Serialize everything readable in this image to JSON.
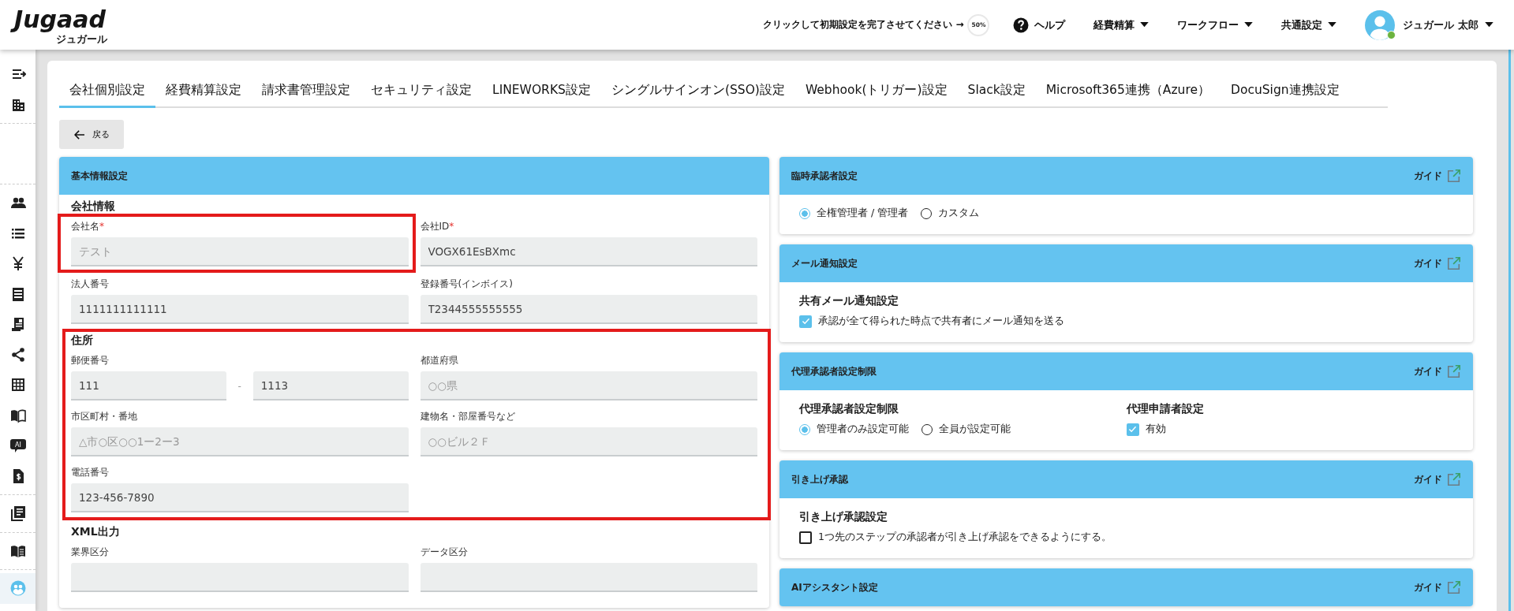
{
  "header": {
    "logo": "Jugaad",
    "logo_sub": "ジュガール",
    "setup_prompt": "クリックして初期設定を完了させてください →",
    "setup_progress": "50%",
    "menus": [
      {
        "label": "ヘルプ",
        "kind": "help"
      },
      {
        "label": "経費精算",
        "kind": "dropdown"
      },
      {
        "label": "ワークフロー",
        "kind": "dropdown"
      },
      {
        "label": "共通設定",
        "kind": "dropdown"
      }
    ],
    "user": {
      "name": "ジュガール 太郎",
      "online": true
    }
  },
  "sidebar": {
    "groups": [
      {
        "items": [
          {
            "selected": false
          },
          {
            "selected": false
          }
        ]
      },
      {
        "items": [
          {
            "selected": false
          },
          {
            "selected": false
          },
          {
            "selected": false
          },
          {
            "selected": false
          },
          {
            "selected": false
          },
          {
            "selected": false
          },
          {
            "selected": false
          },
          {
            "selected": false
          },
          {
            "selected": false,
            "label": "AI"
          },
          {
            "selected": false
          }
        ]
      },
      {
        "items": [
          {
            "selected": false
          }
        ]
      },
      {
        "items": [
          {
            "selected": false
          }
        ]
      },
      {
        "items": [
          {
            "selected": true
          }
        ]
      }
    ]
  },
  "tabs": [
    {
      "label": "会社個別設定",
      "selected": true
    },
    {
      "label": "経費精算設定",
      "selected": false
    },
    {
      "label": "請求書管理設定",
      "selected": false
    },
    {
      "label": "セキュリティ設定",
      "selected": false
    },
    {
      "label": "LINEWORKS設定",
      "selected": false
    },
    {
      "label": "シングルサインオン(SSO)設定",
      "selected": false
    },
    {
      "label": "Webhook(トリガー)設定",
      "selected": false
    },
    {
      "label": "Slack設定",
      "selected": false
    },
    {
      "label": "Microsoft365連携（Azure）",
      "selected": false
    },
    {
      "label": "DocuSign連携設定",
      "selected": false
    }
  ],
  "back_button": "戻る",
  "basic_panel": {
    "title": "基本情報設定",
    "sections": [
      {
        "title": "会社情報",
        "highlighted": false,
        "fields": [
          {
            "kind": "text",
            "label": "会社名",
            "required_mark": "*",
            "placeholder": "テスト",
            "highlighted": true
          },
          {
            "kind": "text",
            "label": "会社ID",
            "required_mark": "*",
            "value": "VOGX61EsBXmc",
            "highlighted": false
          },
          {
            "kind": "text",
            "label": "法人番号",
            "value": "1111111111111",
            "highlighted": false
          },
          {
            "kind": "text",
            "label": "登録番号(インボイス)",
            "value": "T2344555555555",
            "highlighted": false
          }
        ]
      },
      {
        "title": "住所",
        "highlighted": true,
        "fields": [
          {
            "kind": "postal",
            "label": "郵便番号",
            "values": [
              "111",
              "1113"
            ],
            "separator": "-",
            "highlighted": false
          },
          {
            "kind": "text",
            "label": "都道府県",
            "placeholder": "○○県",
            "highlighted": false
          },
          {
            "kind": "text",
            "label": "市区町村・番地",
            "placeholder": "△市○区○○1ー2ー3",
            "highlighted": false
          },
          {
            "kind": "text",
            "label": "建物名・部屋番号など",
            "placeholder": "○○ビル２Ｆ",
            "highlighted": false
          },
          {
            "kind": "text",
            "label": "電話番号",
            "value": "123-456-7890",
            "highlighted": false
          }
        ]
      },
      {
        "title": "XML出力",
        "highlighted": false,
        "fields": [
          {
            "kind": "text",
            "label": "業界区分",
            "highlighted": false
          },
          {
            "kind": "text",
            "label": "データ区分",
            "highlighted": false
          }
        ]
      }
    ]
  },
  "side_panels": [
    {
      "title": "臨時承認者設定",
      "guide": "ガイド",
      "groups": [
        {
          "controls": [
            {
              "kind": "radio",
              "label": "全権管理者 / 管理者",
              "selected": true
            },
            {
              "kind": "radio",
              "label": "カスタム",
              "selected": false
            }
          ]
        }
      ]
    },
    {
      "title": "メール通知設定",
      "guide": "ガイド",
      "groups": [
        {
          "heading": "共有メール通知設定",
          "controls": [
            {
              "kind": "checkbox",
              "label": "承認が全て得られた時点で共有者にメール通知を送る",
              "checked": true
            }
          ]
        }
      ]
    },
    {
      "title": "代理承認者設定制限",
      "guide": "ガイド",
      "groups": [
        {
          "heading": "代理承認者設定制限",
          "controls": [
            {
              "kind": "radio",
              "label": "管理者のみ設定可能",
              "selected": true
            },
            {
              "kind": "radio",
              "label": "全員が設定可能",
              "selected": false
            }
          ]
        },
        {
          "heading": "代理申請者設定",
          "controls": [
            {
              "kind": "checkbox",
              "label": "有効",
              "checked": true
            }
          ]
        }
      ]
    },
    {
      "title": "引き上げ承認",
      "guide": "ガイド",
      "groups": [
        {
          "heading": "引き上げ承認設定",
          "controls": [
            {
              "kind": "checkbox",
              "label": "1つ先のステップの承認者が引き上げ承認をできるようにする。",
              "checked": false
            }
          ]
        }
      ]
    },
    {
      "title": "AIアシスタント設定",
      "guide": "ガイド"
    }
  ]
}
